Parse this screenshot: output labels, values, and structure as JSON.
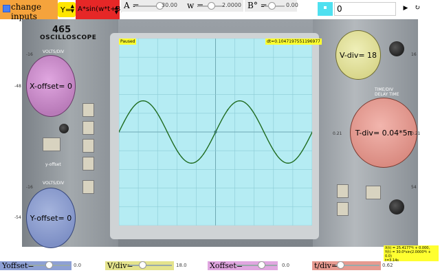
{
  "colors": {
    "checkbox_group": "#f5a33c",
    "y_select": "#ffe600",
    "func_select": "#e62727",
    "screen": "#b5ecf3",
    "trace": "#1f6b1f",
    "x_offset_dial": "#c890c8",
    "y_offset_dial": "#8e9fd0",
    "v_div_dial": "#e4e3a0",
    "t_div_dial": "#e69e94",
    "yoffset_bar": "#8ea0d4",
    "vdiv_bar": "#e4e38c",
    "xoffset_bar": "#e0a6e0",
    "tdiv_bar": "#e69a90",
    "tag_bg": "#ffff30",
    "color_button": "#4fe0f0"
  },
  "toolbar": {
    "change_inputs_label": "change inputs",
    "change_inputs_checked": true,
    "y_select_value": "Y=",
    "function_select_value": "A*sin(w*t+B)",
    "A": {
      "label": "A =",
      "value": "30.00",
      "level": 0.6
    },
    "w": {
      "label": "w =",
      "value": "2.0000",
      "level": 0.45
    },
    "B": {
      "label": "B° =",
      "value": "0.00",
      "level": 0.3
    },
    "number_input_value": "0",
    "play_icon": "play-icon",
    "reset_icon": "reset-icon"
  },
  "scope": {
    "brand_number": "465",
    "brand_name": "OSCILLOSCOPE",
    "volts_div_label": "VOLTS/DIV",
    "volts_div_label_2": "VOLTS/DIV",
    "delay_time_label": "TIME/DIV\nDELAY TIME",
    "y_offset_label": "y-offset",
    "paused_tag": "Paused",
    "dt_tag": "dt=0.1047197551196977",
    "side_labels": {
      "left_top": "-16",
      "left_mid": "-48",
      "left_low": "-16",
      "left_bot": "-54",
      "right_mid": "0.21",
      "right_mid2": "0.21",
      "right_top": "16",
      "right_bot": "54"
    }
  },
  "dials": {
    "x_offset": "X-offset= 0",
    "y_offset": "Y-offset= 0",
    "v_div": "V-div= 18",
    "t_div": "T-div= 0.04*5π"
  },
  "readout": {
    "line1": "X(t) = 25.4177*t + 0.000,",
    "line2": "Y(t) = 30.0*sin(2.0000*t + 0.0)",
    "line3": "t=3.14s"
  },
  "bottom": {
    "yoffset": {
      "label": "Yoffset=",
      "value": "0.0",
      "level": 0.5
    },
    "vdiv": {
      "label": "V/div=",
      "value": "18.0",
      "level": 0.5
    },
    "xoffset": {
      "label": "Xoffset=",
      "value": "0.0",
      "level": 0.5
    },
    "tdiv": {
      "label": "t/div=",
      "value": "0.62",
      "level": 0.2
    }
  },
  "chart_data": {
    "type": "line",
    "series": [
      {
        "x": [
          0,
          0.39,
          0.79,
          1.18,
          1.57,
          1.96,
          2.36,
          2.75,
          3.14,
          3.53,
          3.93,
          4.32,
          4.71,
          5.11,
          5.5,
          5.89,
          6.28
        ],
        "y": [
          0,
          21.2,
          30,
          21.2,
          0,
          -21.2,
          -30,
          -21.2,
          0,
          21.2,
          30,
          21.2,
          0,
          -21.2,
          -30,
          -21.2,
          0
        ]
      }
    ],
    "xlim": [
      0,
      6.28
    ],
    "ylim": [
      -90,
      90
    ],
    "grid": true
  }
}
